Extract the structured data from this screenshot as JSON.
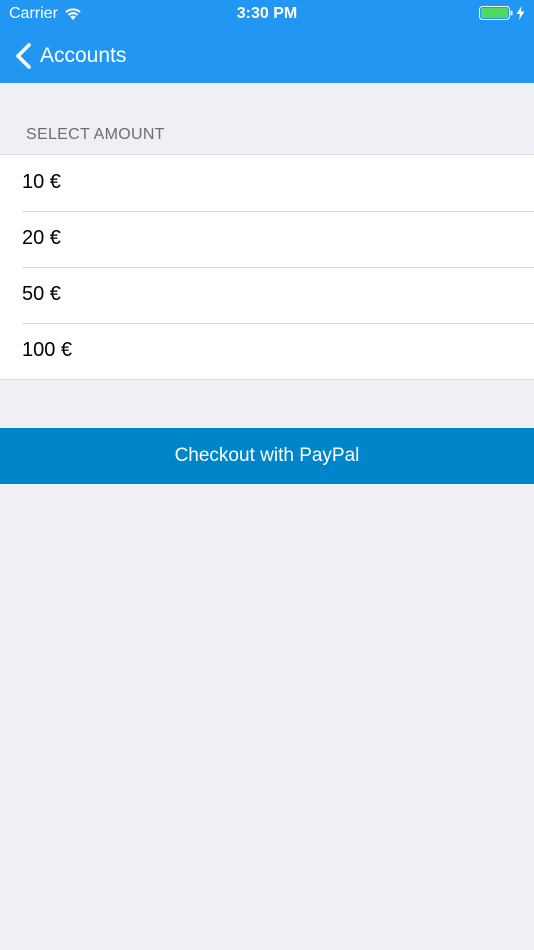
{
  "status_bar": {
    "carrier": "Carrier",
    "time": "3:30 PM",
    "wifi_icon": "wifi-icon",
    "battery_icon": "battery-icon",
    "charging_icon": "bolt-icon"
  },
  "nav": {
    "back_label": "Accounts",
    "back_icon": "chevron-left-icon",
    "bar_color": "#2196F3"
  },
  "section": {
    "header": "SELECT AMOUNT"
  },
  "amounts": [
    {
      "label": "10 €"
    },
    {
      "label": "20 €"
    },
    {
      "label": "50 €"
    },
    {
      "label": "100 €"
    }
  ],
  "checkout": {
    "label": "Checkout with PayPal",
    "color": "#0085CA"
  }
}
